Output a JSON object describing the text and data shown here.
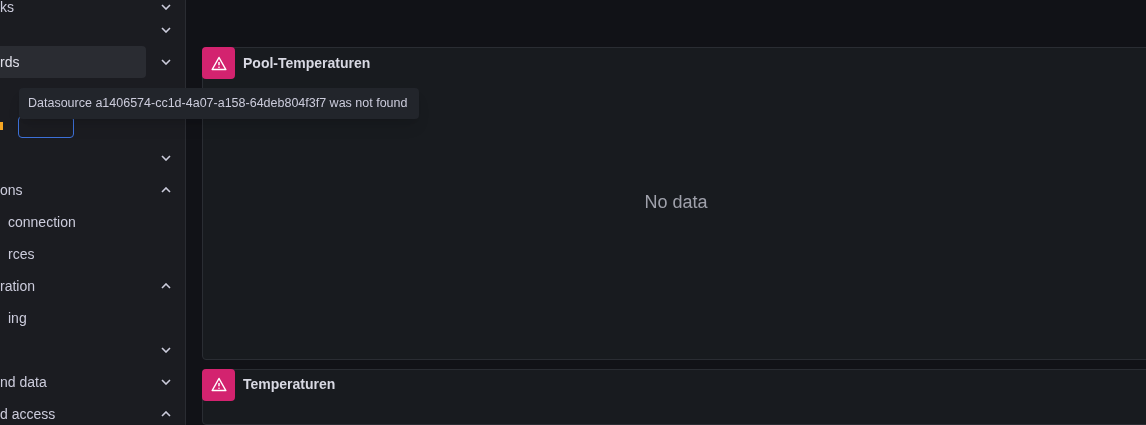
{
  "sidebar": {
    "items": [
      {
        "kind": "link",
        "label": "ks",
        "selected": false,
        "expanded": false
      },
      {
        "kind": "link",
        "selected": false,
        "expanded": false
      },
      {
        "kind": "link",
        "label": "rds",
        "selected": true,
        "expanded": false
      },
      {
        "kind": "marker"
      },
      {
        "kind": "link",
        "selected": false,
        "expanded": false
      },
      {
        "kind": "link",
        "label": "ons",
        "selected": false,
        "expanded": true,
        "children": [
          {
            "label": "connection",
            "selected": false
          },
          {
            "label": "rces",
            "selected": false
          }
        ]
      },
      {
        "kind": "link",
        "label": "ration",
        "selected": false,
        "expanded": true,
        "children": [
          {
            "label": "ing",
            "selected": false
          }
        ]
      },
      {
        "kind": "link",
        "selected": false,
        "expanded": false
      },
      {
        "kind": "link",
        "label": "nd data",
        "selected": false,
        "expanded": false
      },
      {
        "kind": "link",
        "label": "d access",
        "selected": false,
        "expanded": true
      }
    ]
  },
  "tooltip": {
    "text": "Datasource a1406574-cc1d-4a07-a158-64deb804f3f7 was not found"
  },
  "panels": [
    {
      "title": "Pool-Temperaturen",
      "message": "No data"
    },
    {
      "title": "Temperaturen"
    }
  ]
}
